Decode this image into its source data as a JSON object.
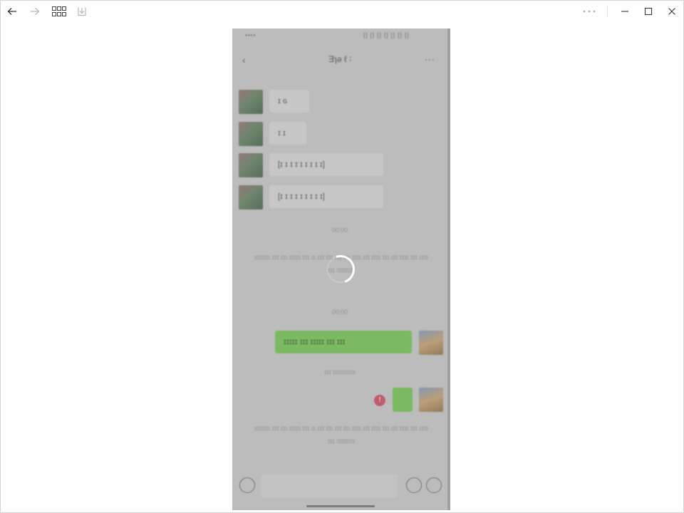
{
  "titlebar": {
    "icons": [
      "arrow-left-icon",
      "arrow-right-icon",
      "grid-icon",
      "download-icon",
      "more-icon",
      "minimize-icon",
      "maximize-icon",
      "close-icon"
    ]
  },
  "image": {
    "status_left": "•••• ",
    "status_right": "[] [] [] [] [] [] []",
    "nav_back": "‹",
    "nav_title": "Ǝɿə ℓ ∶",
    "nav_more": "···",
    "bubbles_in": [
      "ɪ ɢ",
      "ɪ ɪ",
      "[ɪ ɪ ɪ ɪ ɪ ɪ ɪ ɪ ɪ]",
      "[ɪ ɪ ɪ ɪ ɪ ɪ ɪ ɪ ɪ]"
    ],
    "sys_time_1": "00:00",
    "para_1": "ɪɪɪɪɪɪɪ ɪɪɪ ɪɪɪ ɪɪɪɪɪ ɪɪɪ ɪɪ ɪɪɪ ɪɪɪ ɪɪɪ ɪɪɪ ɪɪɪɪ ɪɪɪ ɪɪɪɪ ɪɪɪ ɪɪɪ ɪɪɪɪ ɪɪɪ ɪɪɪɪ ɪɪɪ ɪɪɪɪɪɪɪɪ",
    "sys_time_2": "00:00",
    "bubble_out": "ɪɪɪɪɪ ɪɪɪ ɪɪɪɪɪ ɪɪɪ ɪɪɪ",
    "sys_note": "ɪɪɪ ɪɪɪɪɪɪɪɪɪɪ",
    "err_mark": "!",
    "para_2": "ɪɪɪɪɪɪɪ ɪɪɪ ɪɪɪ ɪɪɪɪɪ ɪɪɪ ɪɪ ɪɪɪ ɪɪɪ ɪɪɪ ɪɪɪ ɪɪɪɪ ɪɪɪ ɪɪɪɪ ɪɪɪ ɪɪɪ ɪɪɪɪ ɪɪɪ ɪɪɪɪ ɪɪɪ ɪɪɪɪɪɪɪɪ"
  },
  "colors": {
    "accent_green": "#6dba4c",
    "overlay_gray": "#bcbcbc",
    "error_red": "#c0485a"
  }
}
